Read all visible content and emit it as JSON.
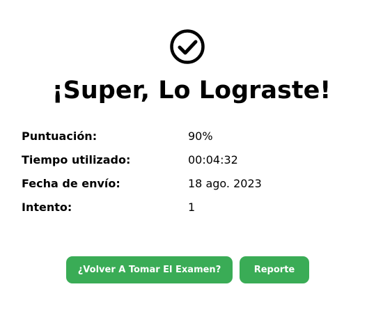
{
  "result": {
    "icon": "check-circle-icon",
    "title": "¡Super, Lo Lograste!"
  },
  "details": [
    {
      "label": "Puntuación:",
      "value": "90%"
    },
    {
      "label": "Tiempo utilizado:",
      "value": "00:04:32"
    },
    {
      "label": "Fecha de envío:",
      "value": "18 ago. 2023"
    },
    {
      "label": "Intento:",
      "value": "1"
    }
  ],
  "actions": {
    "retake_label": "¿Volver A Tomar El Examen?",
    "report_label": "Reporte"
  },
  "colors": {
    "accent": "#3aac56",
    "text": "#000000",
    "background": "#ffffff"
  }
}
